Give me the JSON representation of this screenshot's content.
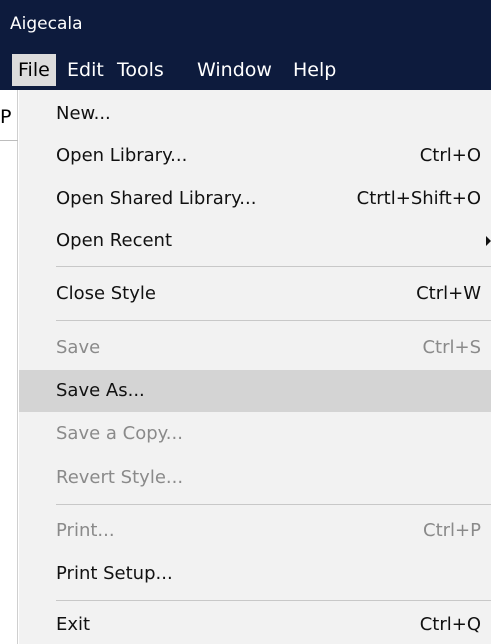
{
  "app": {
    "title": "Aigecala"
  },
  "menubar": {
    "items": [
      {
        "label": "File",
        "active": true
      },
      {
        "label": "Edit"
      },
      {
        "label": "Tools"
      },
      {
        "label": "Window"
      },
      {
        "label": "Help"
      }
    ]
  },
  "left_pane": {
    "partial_text": "P"
  },
  "file_menu": {
    "items": [
      {
        "label": "New...",
        "shortcut": ""
      },
      {
        "label": "Open Library...",
        "shortcut": "Ctrl+O"
      },
      {
        "label": "Open Shared Library...",
        "shortcut": "Ctrtl+Shift+O"
      },
      {
        "label": "Open Recent",
        "shortcut": "",
        "submenu": true
      },
      {
        "label": "Close Style",
        "shortcut": "Ctrl+W"
      },
      {
        "label": "Save",
        "shortcut": "Ctrl+S",
        "disabled": true
      },
      {
        "label": "Save As...",
        "shortcut": "",
        "highlighted": true
      },
      {
        "label": "Save a Copy...",
        "shortcut": "",
        "disabled": true
      },
      {
        "label": "Revert Style...",
        "shortcut": "",
        "disabled": true
      },
      {
        "label": "Print...",
        "shortcut": "Ctrl+P",
        "disabled": true
      },
      {
        "label": "Print Setup...",
        "shortcut": ""
      },
      {
        "label": "Exit",
        "shortcut": "Ctrl+Q"
      }
    ]
  },
  "colors": {
    "titlebar_bg": "#0d1b3d",
    "menu_bg": "#f2f2f2",
    "highlight_bg": "#d4d4d4",
    "disabled_text": "#8a8a8a"
  }
}
